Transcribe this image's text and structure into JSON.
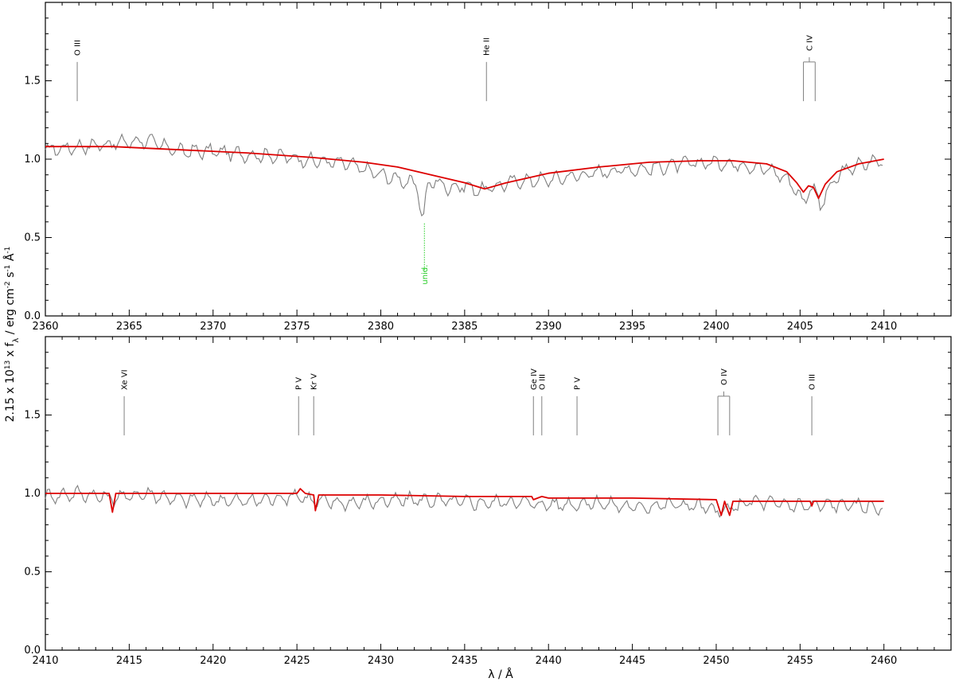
{
  "ylabel": "2.15 x 10^13 x f_λ / erg cm^-2 s^-1 Å^-1",
  "xlabel": "λ / Å",
  "colors": {
    "observation": "#7f7f7f",
    "model": "#dd0000",
    "marker": "#808080",
    "unidentified": "#22cc22"
  },
  "chart_data": [
    {
      "type": "line",
      "xlim": [
        2360,
        2414
      ],
      "ylim": [
        0.0,
        2.0
      ],
      "xticks": [
        2360,
        2365,
        2370,
        2375,
        2380,
        2385,
        2390,
        2395,
        2400,
        2405,
        2410
      ],
      "yticks": [
        0.0,
        0.5,
        1.0,
        1.5
      ],
      "series": [
        {
          "role": "observation",
          "x": [
            2360,
            2362,
            2364,
            2366,
            2368,
            2370,
            2372,
            2374,
            2376,
            2378,
            2380,
            2381.5,
            2382.2,
            2382.5,
            2382.8,
            2383.3,
            2384,
            2385,
            2386,
            2387,
            2388,
            2390,
            2392,
            2394,
            2396,
            2398,
            2400,
            2402,
            2403.5,
            2404.5,
            2405.2,
            2405.5,
            2405.8,
            2406.2,
            2406.8,
            2407.5,
            2408.5,
            2410
          ],
          "y": [
            1.06,
            1.08,
            1.1,
            1.12,
            1.05,
            1.05,
            1.03,
            1.02,
            0.99,
            0.97,
            0.9,
            0.86,
            0.82,
            0.59,
            0.84,
            0.86,
            0.82,
            0.83,
            0.8,
            0.83,
            0.86,
            0.87,
            0.9,
            0.93,
            0.94,
            0.97,
            0.98,
            0.96,
            0.92,
            0.85,
            0.72,
            0.8,
            0.83,
            0.7,
            0.82,
            0.92,
            0.96,
            1.0
          ]
        },
        {
          "role": "model",
          "x": [
            2360,
            2364,
            2368,
            2372,
            2376,
            2379,
            2381,
            2383,
            2385,
            2386.2,
            2387.5,
            2390,
            2393,
            2396,
            2399,
            2401,
            2403,
            2404.2,
            2404.8,
            2405.2,
            2405.5,
            2405.8,
            2406.1,
            2406.5,
            2407.2,
            2408.5,
            2410
          ],
          "y": [
            1.08,
            1.08,
            1.06,
            1.04,
            1.01,
            0.98,
            0.95,
            0.9,
            0.85,
            0.81,
            0.85,
            0.91,
            0.95,
            0.98,
            0.99,
            0.99,
            0.97,
            0.92,
            0.85,
            0.79,
            0.83,
            0.82,
            0.75,
            0.84,
            0.92,
            0.97,
            1.0
          ]
        }
      ],
      "line_markers": [
        {
          "label": "O III",
          "wavelengths": [
            2361.9
          ]
        },
        {
          "label": "He II",
          "wavelengths": [
            2386.3
          ]
        },
        {
          "label": "C IV",
          "wavelengths": [
            2405.2,
            2405.9
          ]
        }
      ],
      "unidentified": [
        {
          "label": "unid.",
          "wavelength": 2382.6
        }
      ]
    },
    {
      "type": "line",
      "xlim": [
        2410,
        2464
      ],
      "ylim": [
        0.0,
        2.0
      ],
      "xticks": [
        2410,
        2415,
        2420,
        2425,
        2430,
        2435,
        2440,
        2445,
        2450,
        2455,
        2460
      ],
      "yticks": [
        0.0,
        0.5,
        1.0,
        1.5
      ],
      "series": [
        {
          "role": "observation",
          "x": [
            2410,
            2412,
            2414,
            2416,
            2418,
            2420,
            2422,
            2424,
            2425,
            2426,
            2428,
            2430,
            2432,
            2434,
            2436,
            2438,
            2439.5,
            2441,
            2443,
            2445,
            2447,
            2449,
            2450.2,
            2450.8,
            2452,
            2454,
            2455.7,
            2457,
            2459,
            2460
          ],
          "y": [
            0.98,
            1.0,
            0.97,
            1.0,
            0.96,
            0.96,
            0.95,
            0.97,
            0.99,
            0.95,
            0.94,
            0.95,
            0.96,
            0.95,
            0.94,
            0.95,
            0.93,
            0.93,
            0.94,
            0.91,
            0.93,
            0.92,
            0.88,
            0.9,
            0.95,
            0.93,
            0.92,
            0.93,
            0.92,
            0.9
          ]
        },
        {
          "role": "model",
          "x": [
            2410,
            2413.8,
            2414.0,
            2414.2,
            2420,
            2425,
            2425.2,
            2425.5,
            2426.0,
            2426.1,
            2426.3,
            2430,
            2435,
            2439.0,
            2439.1,
            2439.6,
            2440,
            2445,
            2450.0,
            2450.3,
            2450.5,
            2450.8,
            2451.0,
            2455.6,
            2455.7,
            2455.8,
            2460
          ],
          "y": [
            1.0,
            1.0,
            0.88,
            1.0,
            1.0,
            1.0,
            1.03,
            1.0,
            0.99,
            0.89,
            0.99,
            0.99,
            0.98,
            0.98,
            0.96,
            0.98,
            0.97,
            0.97,
            0.96,
            0.86,
            0.95,
            0.86,
            0.95,
            0.95,
            0.92,
            0.95,
            0.95
          ]
        }
      ],
      "line_markers": [
        {
          "label": "Xe VI",
          "wavelengths": [
            2414.7
          ]
        },
        {
          "label": "P V",
          "wavelengths": [
            2425.1
          ]
        },
        {
          "label": "Kr V",
          "wavelengths": [
            2426.0
          ]
        },
        {
          "label": "Ge IV",
          "wavelengths": [
            2439.1
          ]
        },
        {
          "label": "O III",
          "wavelengths": [
            2439.6
          ]
        },
        {
          "label": "P V",
          "wavelengths": [
            2441.7
          ]
        },
        {
          "label": "O IV",
          "wavelengths": [
            2450.1,
            2450.8
          ]
        },
        {
          "label": "O III",
          "wavelengths": [
            2455.7
          ]
        }
      ],
      "unidentified": []
    }
  ]
}
